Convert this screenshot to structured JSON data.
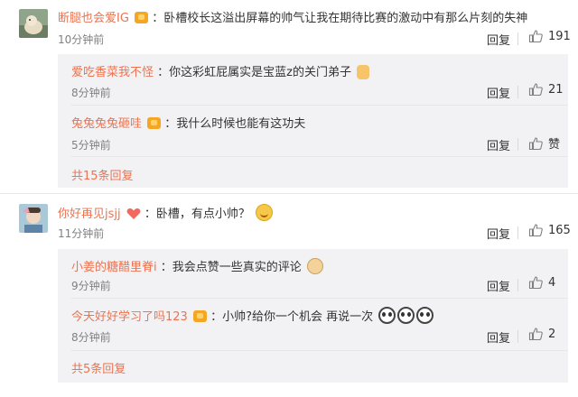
{
  "comments": [
    {
      "user": "断腿也会爱IG",
      "text": "：卧槽校长这溢出屏幕的帅气让我在期待比赛的激动中有那么片刻的失神",
      "time": "10分钟前",
      "reply_label": "回复",
      "likes": "191",
      "replies": [
        {
          "user": "爱吃香菜我不怪",
          "text": "：你这彩虹屁属实是宝蓝z的关门弟子",
          "time": "8分钟前",
          "reply_label": "回复",
          "likes": "21"
        },
        {
          "user": "兔兔兔兔砸哇",
          "text": "：我什么时候也能有这功夫",
          "time": "5分钟前",
          "reply_label": "回复",
          "likes": "赞"
        }
      ],
      "more_label": "共15条回复"
    },
    {
      "user": "你好再见jsjj",
      "text": "：卧槽，有点小帅？",
      "time": "11分钟前",
      "reply_label": "回复",
      "likes": "165",
      "replies": [
        {
          "user": "小姜的糖醋里脊i",
          "text": "：我会点赞一些真实的评论",
          "time": "9分钟前",
          "reply_label": "回复",
          "likes": "4"
        },
        {
          "user": "今天好好学习了吗123",
          "text": "：小帅?给你一个机会 再说一次",
          "time": "8分钟前",
          "reply_label": "回复",
          "likes": "2"
        }
      ],
      "more_label": "共5条回复"
    }
  ],
  "colors": {
    "username": "#eb7350",
    "reply_bg": "#f2f2f5",
    "meta": "#808080"
  },
  "icons": [
    "thumbs-up-icon",
    "vip-badge-icon",
    "smile-emoji-icon",
    "thumb-emoji-icon",
    "dog-emoji-icon",
    "panda-emoji-icon",
    "heart-icon"
  ]
}
